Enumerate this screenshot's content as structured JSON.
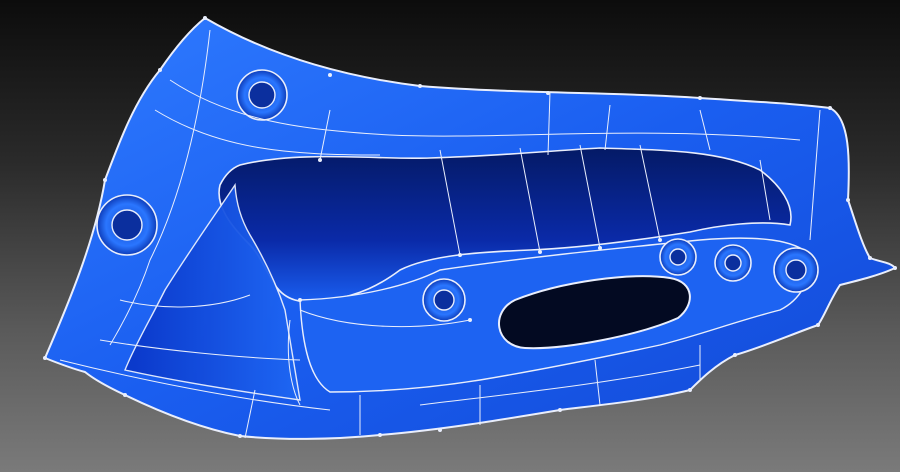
{
  "scene": {
    "model": "stamped-panel-surface-mesh",
    "colors": {
      "background_top": "#0c0c0c",
      "background_bottom": "#7a7a7a",
      "surface_light": "#2f7bff",
      "surface_mid": "#1a5ef0",
      "surface_deep": "#0a2aa8",
      "cavity_dark": "#041a66",
      "edge_lines": "#e9eefc"
    },
    "features": [
      "mounting-hole",
      "mounting-hole",
      "mounting-hole",
      "mounting-hole",
      "mounting-hole",
      "oval-slot"
    ]
  }
}
